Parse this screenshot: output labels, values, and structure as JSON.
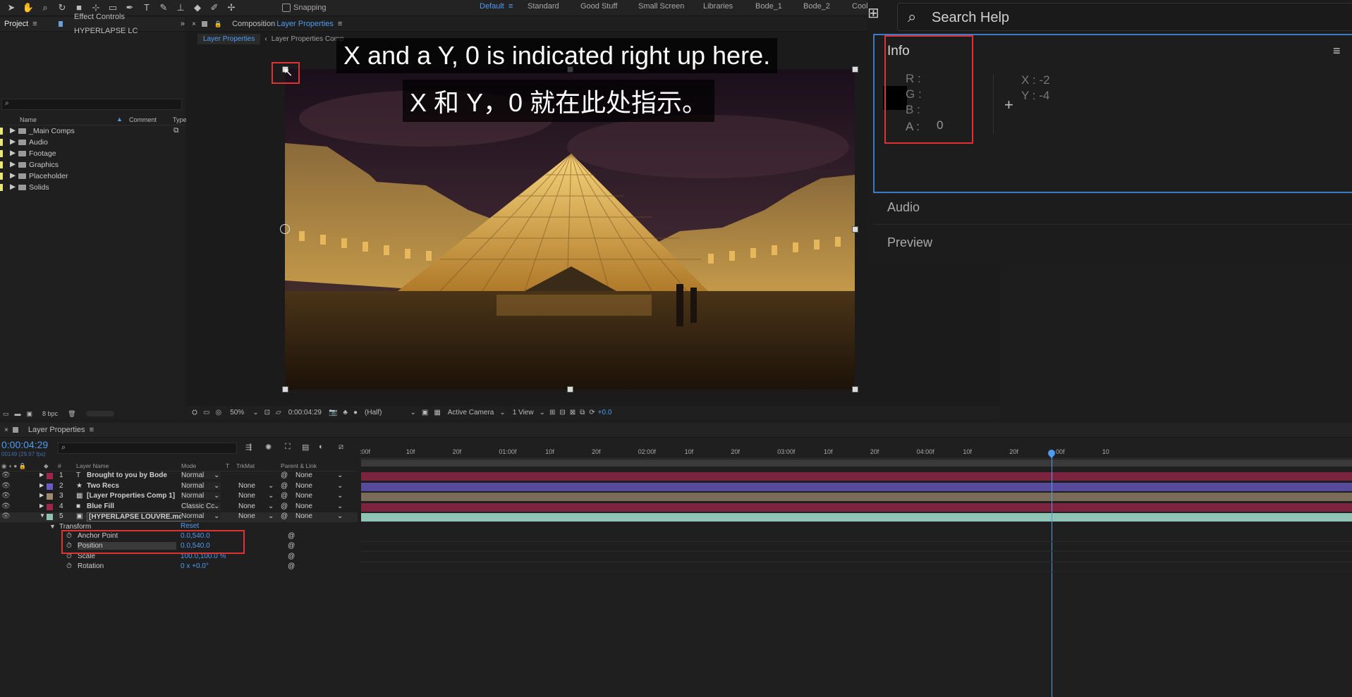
{
  "toolbar": {
    "snapping_label": "Snapping",
    "workspaces": [
      "Default",
      "Standard",
      "Good Stuff",
      "Small Screen",
      "Libraries",
      "Bode_1",
      "Bode_2",
      "Cool"
    ]
  },
  "project_panel": {
    "tab_project": "Project",
    "tab_effect_controls": "Effect Controls HYPERLAPSE LC",
    "col_name": "Name",
    "col_comment": "Comment",
    "col_type": "Type",
    "items": [
      "_Main Comps",
      "Audio",
      "Footage",
      "Graphics",
      "Placeholder",
      "Solids"
    ],
    "bpc": "8 bpc"
  },
  "composition": {
    "tab_prefix": "Composition",
    "tab_name": "Layer Properties",
    "sub_tab_1": "Layer Properties",
    "sub_tab_2": "Layer Properties Comp",
    "zoom": "50%",
    "timecode": "0:00:04:29",
    "resolution": "(Half)",
    "camera": "Active Camera",
    "view": "1 View",
    "exposure": "+0.0"
  },
  "captions": {
    "line1": "X and a Y, 0 is indicated right up here.",
    "line2": "X 和 Y，0 就在此处指示。"
  },
  "search_help": "Search Help",
  "info_panel": {
    "title": "Info",
    "r_label": "R :",
    "g_label": "G :",
    "b_label": "B :",
    "a_label": "A :",
    "a_value": "0",
    "x_readout": "X : -2",
    "y_readout": "Y : -4"
  },
  "audio_panel": "Audio",
  "preview_panel": "Preview",
  "timeline": {
    "tab_name": "Layer Properties",
    "timecode": "0:00:04:29",
    "frame_info": "00149 (29.97 fps)",
    "col_layer_name": "Layer Name",
    "col_mode": "Mode",
    "col_t": "T",
    "col_trkmat": "TrkMat",
    "col_parent": "Parent & Link",
    "ruler": [
      ":00f",
      "10f",
      "20f",
      "01:00f",
      "10f",
      "20f",
      "02:00f",
      "10f",
      "20f",
      "03:00f",
      "10f",
      "20f",
      "04:00f",
      "10f",
      "20f",
      "00f",
      "10"
    ],
    "layers": [
      {
        "num": "1",
        "icon": "T",
        "name": "Brought to you by Bode",
        "mode": "Normal",
        "trkmat": "",
        "parent": "None",
        "label_color": "#a1254a"
      },
      {
        "num": "2",
        "icon": "★",
        "name": "Two Recs",
        "mode": "Normal",
        "trkmat": "None",
        "parent": "None",
        "label_color": "#6b5bc7"
      },
      {
        "num": "3",
        "icon": "▦",
        "name": "[Layer Properties Comp 1]",
        "mode": "Normal",
        "trkmat": "None",
        "parent": "None",
        "label_color": "#a08a70"
      },
      {
        "num": "4",
        "icon": "■",
        "name": "Blue Fill",
        "mode": "Classic Cc",
        "trkmat": "None",
        "parent": "None",
        "label_color": "#a1254a"
      },
      {
        "num": "5",
        "icon": "▣",
        "name": "[HYPERLAPSE LOUVRE.mov]",
        "mode": "Normal",
        "trkmat": "None",
        "parent": "None",
        "label_color": "#8fc3b3"
      }
    ],
    "transform_label": "Transform",
    "reset_label": "Reset",
    "properties": [
      {
        "name": "Anchor Point",
        "value": "0.0,540.0"
      },
      {
        "name": "Position",
        "value": "0.0,540.0"
      },
      {
        "name": "Scale",
        "value": "100.0,100.0 %"
      },
      {
        "name": "Rotation",
        "value": "0 x +0.0°"
      }
    ],
    "bar_colors": [
      "#7a2440",
      "#574a9c",
      "#7a6a58",
      "#7a2440",
      "#8fc3b3"
    ]
  }
}
